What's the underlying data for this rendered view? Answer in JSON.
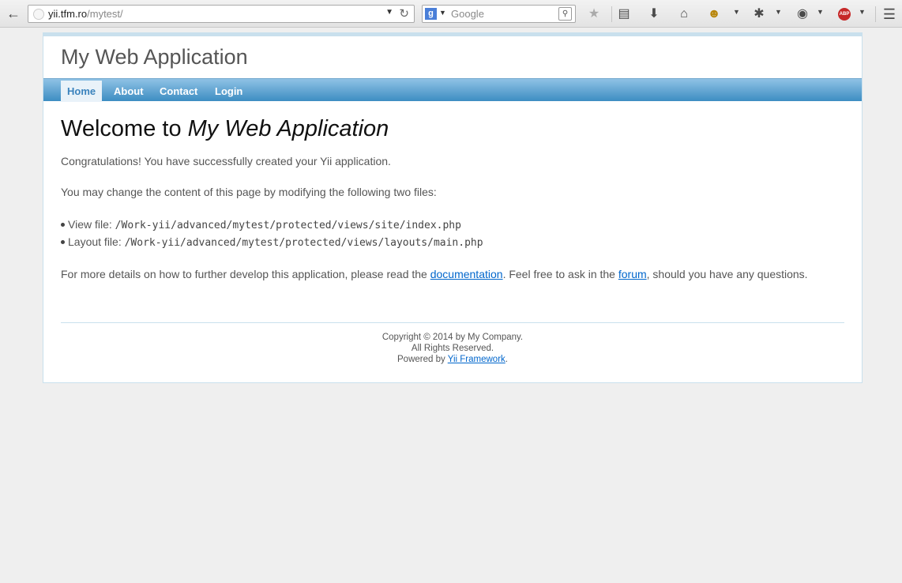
{
  "browser": {
    "url_host": "yii.tfm.ro",
    "url_path": "/mytest/",
    "url_prefix": "",
    "search_placeholder": "Google",
    "search_engine_icon": "g"
  },
  "site": {
    "logo": "My Web Application",
    "menu": [
      {
        "label": "Home",
        "active": true
      },
      {
        "label": "About"
      },
      {
        "label": "Contact"
      },
      {
        "label": "Login"
      }
    ]
  },
  "content": {
    "heading_prefix": "Welcome to ",
    "heading_italic": "My Web Application",
    "congrats": "Congratulations! You have successfully created your Yii application.",
    "intro": "You may change the content of this page by modifying the following two files:",
    "files": [
      {
        "label": "View file: ",
        "path": "/Work-yii/advanced/mytest/protected/views/site/index.php"
      },
      {
        "label": "Layout file: ",
        "path": "/Work-yii/advanced/mytest/protected/views/layouts/main.php"
      }
    ],
    "more_prefix": "For more details on how to further develop this application, please read the ",
    "doc_link": "documentation",
    "more_mid": ". Feel free to ask in the ",
    "forum_link": "forum",
    "more_suffix": ", should you have any questions."
  },
  "footer": {
    "line1": "Copyright © 2014 by My Company.",
    "line2": "All Rights Reserved.",
    "powered_prefix": "Powered by ",
    "powered_link": "Yii Framework",
    "powered_suffix": "."
  },
  "abp_label": "ABP"
}
